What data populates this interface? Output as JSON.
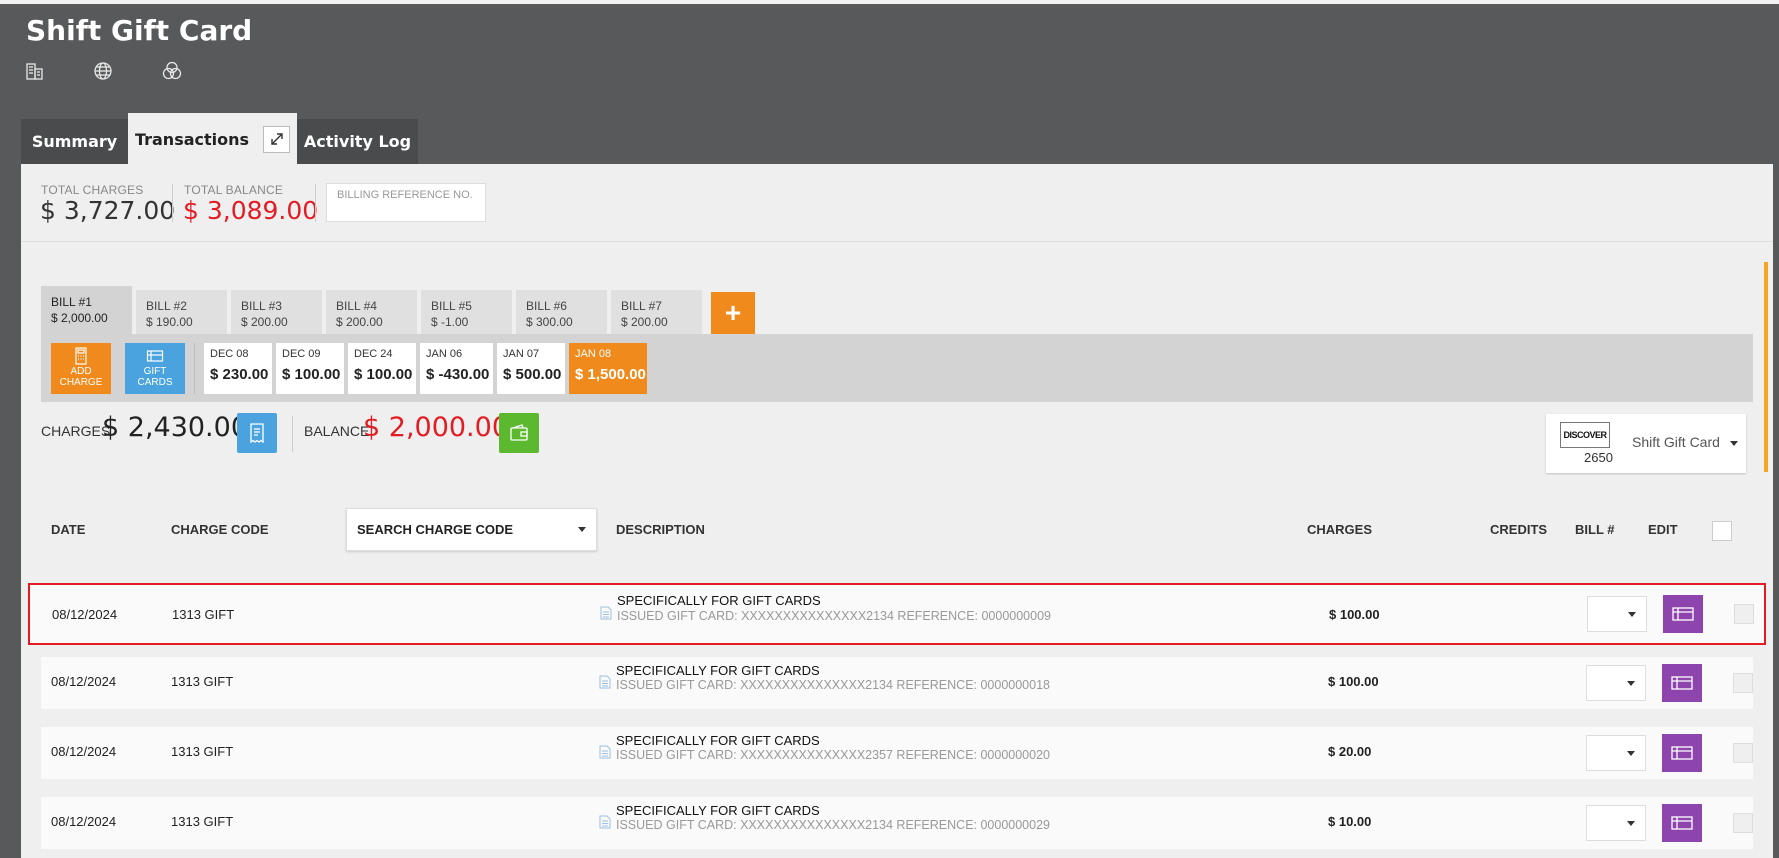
{
  "app": {
    "title": "Shift Gift Card"
  },
  "header_icons": [
    "building-icon",
    "globe-icon",
    "circles-icon"
  ],
  "tabs": {
    "summary": "Summary",
    "transactions": "Transactions",
    "activity_log": "Activity Log"
  },
  "totals": {
    "charges_label": "TOTAL CHARGES",
    "charges_value": "$ 3,727.00",
    "balance_label": "TOTAL BALANCE",
    "balance_value": "$ 3,089.00",
    "billing_ref_placeholder": "BILLING REFERENCE NO."
  },
  "bills": [
    {
      "label": "BILL #1",
      "amount": "$ 2,000.00",
      "active": true
    },
    {
      "label": "BILL #2",
      "amount": "$ 190.00"
    },
    {
      "label": "BILL #3",
      "amount": "$ 200.00"
    },
    {
      "label": "BILL #4",
      "amount": "$ 200.00"
    },
    {
      "label": "BILL #5",
      "amount": "$ -1.00"
    },
    {
      "label": "BILL #6",
      "amount": "$ 300.00"
    },
    {
      "label": "BILL #7",
      "amount": "$ 200.00"
    }
  ],
  "add_bill_label": "+",
  "actions": {
    "add_charge": "ADD CHARGE",
    "gift_cards": "GIFT CARDS"
  },
  "date_chips": [
    {
      "date": "DEC 08",
      "value": "$ 230.00"
    },
    {
      "date": "DEC 09",
      "value": "$ 100.00"
    },
    {
      "date": "DEC 24",
      "value": "$ 100.00"
    },
    {
      "date": "JAN 06",
      "value": "$ -430.00"
    },
    {
      "date": "JAN 07",
      "value": "$ 500.00"
    },
    {
      "date": "JAN 08",
      "value": "$ 1,500.00",
      "selected": true
    }
  ],
  "bill_summary": {
    "charges_label": "CHARGES",
    "charges_value": "$ 2,430.00",
    "balance_label": "BALANCE",
    "balance_value": "$ 2,000.00"
  },
  "payment_card": {
    "brand": "DISCOVER",
    "last4": "2650",
    "name": "Shift Gift Card"
  },
  "table": {
    "headers": {
      "date": "DATE",
      "charge_code": "CHARGE CODE",
      "search_charge_code": "SEARCH CHARGE CODE",
      "description": "DESCRIPTION",
      "charges": "CHARGES",
      "credits": "CREDITS",
      "bill_no": "BILL #",
      "edit": "EDIT"
    },
    "rows": [
      {
        "date": "08/12/2024",
        "code": "1313 GIFT",
        "desc": "SPECIFICALLY FOR GIFT CARDS",
        "sub": "ISSUED GIFT CARD: XXXXXXXXXXXXXXX2134 REFERENCE: 0000000009",
        "charges": "$ 100.00",
        "highlighted": true
      },
      {
        "date": "08/12/2024",
        "code": "1313 GIFT",
        "desc": "SPECIFICALLY FOR GIFT CARDS",
        "sub": "ISSUED GIFT CARD: XXXXXXXXXXXXXXX2134 REFERENCE: 0000000018",
        "charges": "$ 100.00"
      },
      {
        "date": "08/12/2024",
        "code": "1313 GIFT",
        "desc": "SPECIFICALLY FOR GIFT CARDS",
        "sub": "ISSUED GIFT CARD: XXXXXXXXXXXXXXX2357 REFERENCE: 0000000020",
        "charges": "$ 20.00"
      },
      {
        "date": "08/12/2024",
        "code": "1313 GIFT",
        "desc": "SPECIFICALLY FOR GIFT CARDS",
        "sub": "ISSUED GIFT CARD: XXXXXXXXXXXXXXX2134 REFERENCE: 0000000029",
        "charges": "$ 10.00"
      }
    ]
  },
  "colors": {
    "accent_orange": "#f08a1c",
    "balance_red": "#e31b23",
    "edit_purple": "#8e44ad",
    "wallet_green": "#5cb82e",
    "receipt_blue": "#4aa3df"
  }
}
